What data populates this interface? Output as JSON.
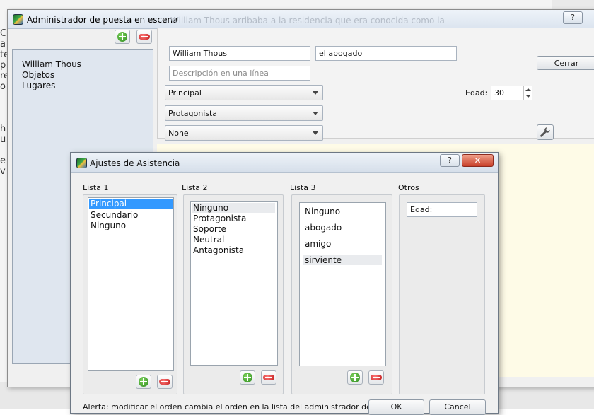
{
  "manager": {
    "title": "Administrador de puesta en escena",
    "ghost_text": "William Thous arribaba a la residencia que era conocida como la",
    "help_label": "?",
    "list_items": [
      "William Thous",
      "Objetos",
      "Lugares"
    ],
    "name_value": "William Thous",
    "alias_value": "el abogado",
    "description_placeholder": "Descripción en una línea",
    "role1_value": "Principal",
    "role2_value": "Protagonista",
    "role3_value": "None",
    "close_label": "Cerrar",
    "age_label": "Edad:",
    "age_value": "30"
  },
  "background_letters": [
    "C",
    "a",
    "te",
    "",
    "p",
    "re",
    "o",
    "",
    "",
    "",
    "h",
    "u",
    "",
    "e",
    "v"
  ],
  "dialog": {
    "title": "Ajustes de Asistencia",
    "help_label": "?",
    "close_label": "✕",
    "list1_label": "Lista 1",
    "list1_items": [
      "Principal",
      "Secundario",
      "Ninguno"
    ],
    "list2_label": "Lista 2",
    "list2_items": [
      "Ninguno",
      "Protagonista",
      "Soporte",
      "Neutral",
      "Antagonista"
    ],
    "list3_label": "Lista 3",
    "list3_items": [
      "Ninguno",
      "abogado",
      "amigo",
      "sirviente"
    ],
    "others_label": "Otros",
    "others_field_value": "Edad:",
    "alert_text": "Alerta: modificar el orden cambia el orden en la lista del administrador de asistencia",
    "ok_label": "OK",
    "cancel_label": "Cancel"
  }
}
